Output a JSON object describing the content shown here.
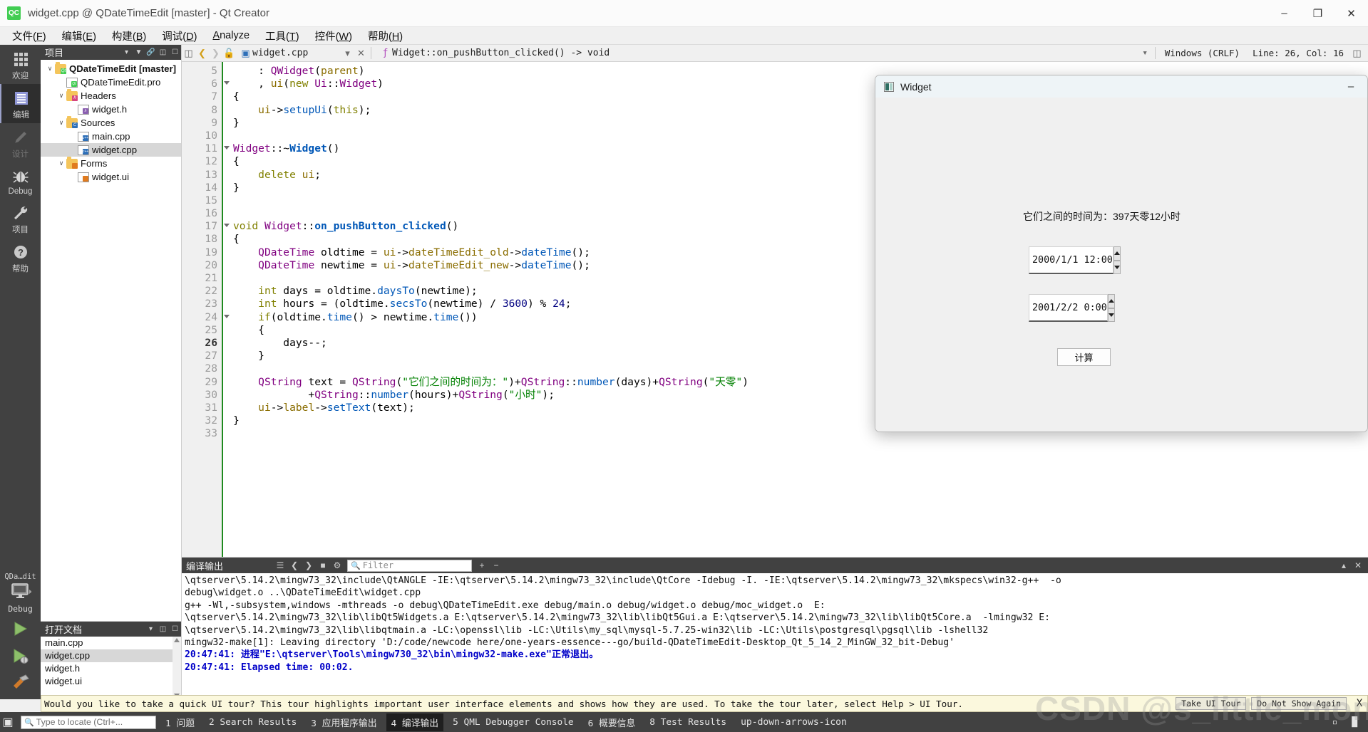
{
  "window": {
    "title": "widget.cpp @ QDateTimeEdit [master] - Qt Creator",
    "logo_text": "QC",
    "minimize": "–",
    "maximize": "❐",
    "close": "✕"
  },
  "menubar": [
    {
      "label": "文件(F)",
      "name": "menu-file"
    },
    {
      "label": "编辑(E)",
      "name": "menu-edit"
    },
    {
      "label": "构建(B)",
      "name": "menu-build"
    },
    {
      "label": "调试(D)",
      "name": "menu-debug"
    },
    {
      "label": "Analyze",
      "name": "menu-analyze"
    },
    {
      "label": "工具(T)",
      "name": "menu-tools"
    },
    {
      "label": "控件(W)",
      "name": "menu-window"
    },
    {
      "label": "帮助(H)",
      "name": "menu-help"
    }
  ],
  "modebar": {
    "items": [
      {
        "label": "欢迎",
        "icon": "grid-icon",
        "active": false,
        "dim": false
      },
      {
        "label": "编辑",
        "icon": "document-lines-icon",
        "active": true,
        "dim": false
      },
      {
        "label": "设计",
        "icon": "pencil-icon",
        "active": false,
        "dim": true
      },
      {
        "label": "Debug",
        "icon": "bug-icon",
        "active": false,
        "dim": false
      },
      {
        "label": "项目",
        "icon": "wrench-icon",
        "active": false,
        "dim": false
      },
      {
        "label": "帮助",
        "icon": "question-circle-icon",
        "active": false,
        "dim": false
      }
    ],
    "kit": {
      "project": "QDa…dit",
      "config": "Debug",
      "run_icon": "play-icon",
      "debug_icon": "play-bug-icon",
      "build_icon": "hammer-icon"
    }
  },
  "project_panel": {
    "title": "项目",
    "dropdown_icon": "chevron-down-icon",
    "filter_icon": "filter-icon",
    "link_icon": "link-icon",
    "tree": [
      {
        "label": "QDateTimeEdit [master]",
        "depth": 0,
        "icon": "folder-qt",
        "twisty": "∨",
        "bold": true,
        "selected": false
      },
      {
        "label": "QDateTimeEdit.pro",
        "depth": 1,
        "icon": "file-pro",
        "twisty": "",
        "bold": false,
        "selected": false
      },
      {
        "label": "Headers",
        "depth": 1,
        "icon": "folder-h",
        "twisty": "∨",
        "bold": false,
        "selected": false
      },
      {
        "label": "widget.h",
        "depth": 2,
        "icon": "file-h",
        "twisty": "",
        "bold": false,
        "selected": false
      },
      {
        "label": "Sources",
        "depth": 1,
        "icon": "folder-cpp",
        "twisty": "∨",
        "bold": false,
        "selected": false
      },
      {
        "label": "main.cpp",
        "depth": 2,
        "icon": "file-cpp",
        "twisty": "",
        "bold": false,
        "selected": false
      },
      {
        "label": "widget.cpp",
        "depth": 2,
        "icon": "file-cpp",
        "twisty": "",
        "bold": false,
        "selected": true
      },
      {
        "label": "Forms",
        "depth": 1,
        "icon": "folder-ui",
        "twisty": "∨",
        "bold": false,
        "selected": false
      },
      {
        "label": "widget.ui",
        "depth": 2,
        "icon": "file-ui",
        "twisty": "",
        "bold": false,
        "selected": false
      }
    ]
  },
  "open_documents": {
    "title": "打开文档",
    "dropdown_icon": "chevron-down-icon",
    "split_icon": "split-icon",
    "close_icon": "close-panel-icon",
    "items": [
      {
        "label": "main.cpp",
        "selected": false
      },
      {
        "label": "widget.cpp",
        "selected": true
      },
      {
        "label": "widget.h",
        "selected": false
      },
      {
        "label": "widget.ui",
        "selected": false
      }
    ]
  },
  "editor_toolbar": {
    "back_icon": "back-arrow-icon",
    "forward_icon": "forward-arrow-icon",
    "lock_icon": "unlock-icon",
    "file_icon": "cpp-file-icon",
    "file_name": "widget.cpp",
    "file_dropdown_icon": "chevron-down-icon",
    "file_close_icon": "close-icon",
    "symbol_icon": "function-icon",
    "symbol_name": "Widget::on_pushButton_clicked() -> void",
    "symbol_dropdown_icon": "chevron-down-icon",
    "line_ending": "Windows (CRLF)",
    "cursor_pos": "Line: 26, Col: 16",
    "split_icon": "split-editor-icon"
  },
  "code": {
    "first_line": 5,
    "current_line": 26,
    "lines": [
      {
        "n": 5,
        "fold": false,
        "html": "    : <ty>QWidget</ty>(<va>parent</va>)"
      },
      {
        "n": 6,
        "fold": true,
        "html": "    , <va>ui</va>(<k>new</k> <ty>Ui</ty>::<ty>Widget</ty>)"
      },
      {
        "n": 7,
        "fold": false,
        "html": "{"
      },
      {
        "n": 8,
        "fold": false,
        "html": "    <va>ui</va>-><fn>setupUi</fn>(<k>this</k>);"
      },
      {
        "n": 9,
        "fold": false,
        "html": "}"
      },
      {
        "n": 10,
        "fold": false,
        "html": ""
      },
      {
        "n": 11,
        "fold": true,
        "html": "<ty>Widget</ty>::~<fb>Widget</fb>()"
      },
      {
        "n": 12,
        "fold": false,
        "html": "{"
      },
      {
        "n": 13,
        "fold": false,
        "html": "    <k>delete</k> <va>ui</va>;"
      },
      {
        "n": 14,
        "fold": false,
        "html": "}"
      },
      {
        "n": 15,
        "fold": false,
        "html": ""
      },
      {
        "n": 16,
        "fold": false,
        "html": ""
      },
      {
        "n": 17,
        "fold": true,
        "html": "<k>void</k> <ty>Widget</ty>::<fb>on_pushButton_clicked</fb>()"
      },
      {
        "n": 18,
        "fold": false,
        "html": "{"
      },
      {
        "n": 19,
        "fold": false,
        "html": "    <ty>QDateTime</ty> oldtime = <va>ui</va>-><va>dateTimeEdit_old</va>-><fn>dateTime</fn>();"
      },
      {
        "n": 20,
        "fold": false,
        "html": "    <ty>QDateTime</ty> newtime = <va>ui</va>-><va>dateTimeEdit_new</va>-><fn>dateTime</fn>();"
      },
      {
        "n": 21,
        "fold": false,
        "html": ""
      },
      {
        "n": 22,
        "fold": false,
        "html": "    <k>int</k> days = oldtime.<fn>daysTo</fn>(newtime);"
      },
      {
        "n": 23,
        "fold": false,
        "html": "    <k>int</k> hours = (oldtime.<fn>secsTo</fn>(newtime) / <nu>3600</nu>) % <nu>24</nu>;"
      },
      {
        "n": 24,
        "fold": true,
        "html": "    <k>if</k>(oldtime.<fn>time</fn>() <op>&gt;</op> newtime.<fn>time</fn>())"
      },
      {
        "n": 25,
        "fold": false,
        "html": "    {"
      },
      {
        "n": 26,
        "fold": false,
        "html": "        days--;"
      },
      {
        "n": 27,
        "fold": false,
        "html": "    }"
      },
      {
        "n": 28,
        "fold": false,
        "html": ""
      },
      {
        "n": 29,
        "fold": false,
        "html": "    <ty>QString</ty> text = <ty>QString</ty>(<st>\"它们之间的时间为：\"</st>)+<ty>QString</ty>::<fn>number</fn>(days)+<ty>QString</ty>(<st>\"天零\"</st>)"
      },
      {
        "n": 30,
        "fold": false,
        "html": "            +<ty>QString</ty>::<fn>number</fn>(hours)+<ty>QString</ty>(<st>\"小时\"</st>);"
      },
      {
        "n": 31,
        "fold": false,
        "html": "    <va>ui</va>-><va>label</va>-><fn>setText</fn>(text);"
      },
      {
        "n": 32,
        "fold": false,
        "html": "}"
      },
      {
        "n": 33,
        "fold": false,
        "html": ""
      }
    ]
  },
  "output_pane": {
    "title": "编译输出",
    "toolbar_icons": [
      "flat-list-icon",
      "prev-icon",
      "next-icon",
      "stop-icon",
      "gear-icon"
    ],
    "filter_placeholder": "Filter",
    "search_icon": "search-icon",
    "zoom_in": "+",
    "zoom_out": "−",
    "collapse_icon": "chevron-up-icon",
    "close_icon": "close-icon",
    "lines": [
      {
        "text": "\\qtserver\\5.14.2\\mingw73_32\\include\\QtANGLE -IE:\\qtserver\\5.14.2\\mingw73_32\\include\\QtCore -Idebug -I. -IE:\\qtserver\\5.14.2\\mingw73_32\\mkspecs\\win32-g++  -o",
        "blue": false
      },
      {
        "text": "debug\\widget.o ..\\QDateTimeEdit\\widget.cpp",
        "blue": false
      },
      {
        "text": "g++ -Wl,-subsystem,windows -mthreads -o debug\\QDateTimeEdit.exe debug/main.o debug/widget.o debug/moc_widget.o  E:",
        "blue": false
      },
      {
        "text": "\\qtserver\\5.14.2\\mingw73_32\\lib\\libQt5Widgets.a E:\\qtserver\\5.14.2\\mingw73_32\\lib\\libQt5Gui.a E:\\qtserver\\5.14.2\\mingw73_32\\lib\\libQt5Core.a  -lmingw32 E:",
        "blue": false
      },
      {
        "text": "\\qtserver\\5.14.2\\mingw73_32\\lib\\libqtmain.a -LC:\\openssl\\lib -LC:\\Utils\\my_sql\\mysql-5.7.25-win32\\lib -LC:\\Utils\\postgresql\\pgsql\\lib -lshell32",
        "blue": false
      },
      {
        "text": "mingw32-make[1]: Leaving directory 'D:/code/newcode here/one-years-essence---go/build-QDateTimeEdit-Desktop_Qt_5_14_2_MinGW_32_bit-Debug'",
        "blue": false
      },
      {
        "text": "20:47:41: 进程\"E:\\qtserver\\Tools\\mingw730_32\\bin\\mingw32-make.exe\"正常退出。",
        "blue": true
      },
      {
        "text": "20:47:41: Elapsed time: 00:02.",
        "blue": true
      }
    ]
  },
  "widget_app": {
    "title": "Widget",
    "icon": "widget-app-icon",
    "minimize": "–",
    "result_label": "它们之间的时间为：397天零12小时",
    "date_old": "2000/1/1 12:00",
    "date_new": "2001/2/2 0:00",
    "calc_button": "计算",
    "spin_up_icon": "triangle-up-icon",
    "spin_down_icon": "triangle-down-icon"
  },
  "tour_bar": {
    "message": "Would you like to take a quick UI tour? This tour highlights important user interface elements and shows how they are used. To take the tour later, select Help > UI Tour.",
    "take_tour": "Take UI Tour",
    "do_not_show": "Do Not Show Again",
    "close": "X"
  },
  "statusbar": {
    "panel_icon": "panel-toggle-icon",
    "locate_placeholder": "Type to locate (Ctrl+...",
    "search_icon": "search-icon",
    "tabs": [
      {
        "label": "1 问题",
        "selected": false
      },
      {
        "label": "2 Search Results",
        "selected": false
      },
      {
        "label": "3 应用程序输出",
        "selected": false
      },
      {
        "label": "4 编译输出",
        "selected": true
      },
      {
        "label": "5 QML Debugger Console",
        "selected": false
      },
      {
        "label": "6 概要信息",
        "selected": false
      },
      {
        "label": "8 Test Results",
        "selected": false
      }
    ],
    "updown_icon": "up-down-arrows-icon",
    "right_icons": [
      "minimize-pane-icon",
      "maximize-pane-icon"
    ]
  },
  "watermark": "CSDN @s_little_monster",
  "colors": {
    "accent": "#41cd52",
    "dark_chrome": "#414141",
    "selection": "#d7d7d7",
    "output_blue": "#0000c8",
    "tour_bg": "#fbf8dd"
  }
}
